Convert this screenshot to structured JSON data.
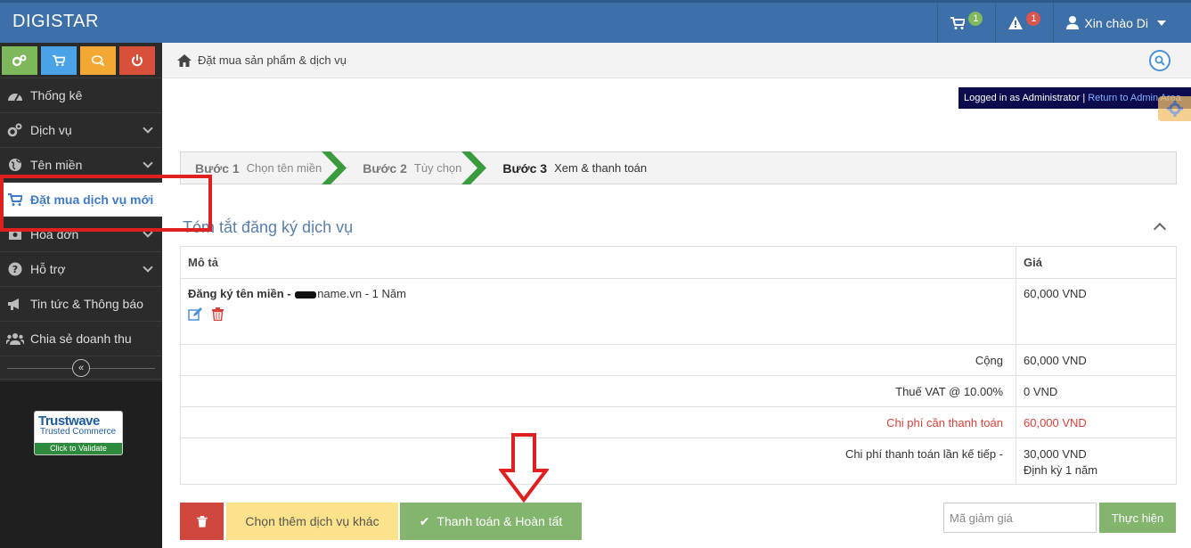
{
  "brand": "DIGISTAR",
  "topbar": {
    "cart_count": "1",
    "alert_count": "1",
    "user_greeting": "Xin chào Di"
  },
  "sidebar": {
    "items": [
      {
        "label": "Thống kê",
        "icon": "dashboard-icon",
        "has_sub": false
      },
      {
        "label": "Dịch vụ",
        "icon": "cogs-icon",
        "has_sub": true
      },
      {
        "label": "Tên miền",
        "icon": "globe-icon",
        "has_sub": true
      },
      {
        "label": "Đặt mua dịch vụ mới",
        "icon": "cart-icon",
        "has_sub": false,
        "active": true
      },
      {
        "label": "Hóa đơn",
        "icon": "invoice-icon",
        "has_sub": true
      },
      {
        "label": "Hỗ trợ",
        "icon": "question-icon",
        "has_sub": true
      },
      {
        "label": "Tin tức & Thông báo",
        "icon": "megaphone-icon",
        "has_sub": false
      },
      {
        "label": "Chia sẻ doanh thu",
        "icon": "users-icon",
        "has_sub": false
      }
    ],
    "trustwave": {
      "title": "Trustwave",
      "sub": "Trusted Commerce",
      "cta": "Click to Validate"
    }
  },
  "breadcrumb": "Đặt mua sản phẩm & dịch vụ",
  "admin": {
    "text": "Logged in as Administrator",
    "sep": "|",
    "link": "Return to Admin Area"
  },
  "steps": [
    {
      "num": "Bước 1",
      "label": "Chọn tên miền"
    },
    {
      "num": "Bước 2",
      "label": "Tùy chọn"
    },
    {
      "num": "Bước 3",
      "label": "Xem & thanh toán"
    }
  ],
  "summary": {
    "title": "Tóm tắt đăng ký dịch vụ",
    "col_desc": "Mô tả",
    "col_price": "Giá",
    "item_prefix": "Đăng ký tên miền -",
    "item_domain": "name.vn",
    "item_period": "- 1 Năm",
    "item_price": "60,000 VND",
    "subtotal_label": "Cộng",
    "subtotal_value": "60,000 VND",
    "vat_label": "Thuế VAT @ 10.00%",
    "vat_value": "0 VND",
    "due_label": "Chi phí cần thanh toán",
    "due_value": "60,000 VND",
    "next_label": "Chi phí thanh toán lần kế tiếp -",
    "next_value": "30,000 VND",
    "next_cycle": "Định kỳ 1 năm"
  },
  "actions": {
    "more_label": "Chọn thêm dịch vụ khác",
    "checkout_label": "Thanh toán & Hoàn tất",
    "promo_placeholder": "Mã giảm giá",
    "apply_label": "Thực hiện"
  },
  "colors": {
    "brand_blue": "#3d6fa8",
    "sidebar_bg": "#2b2b2b",
    "green": "#83b56e",
    "red": "#d0473d",
    "yellow": "#fce28a",
    "highlight": "#e02020"
  }
}
